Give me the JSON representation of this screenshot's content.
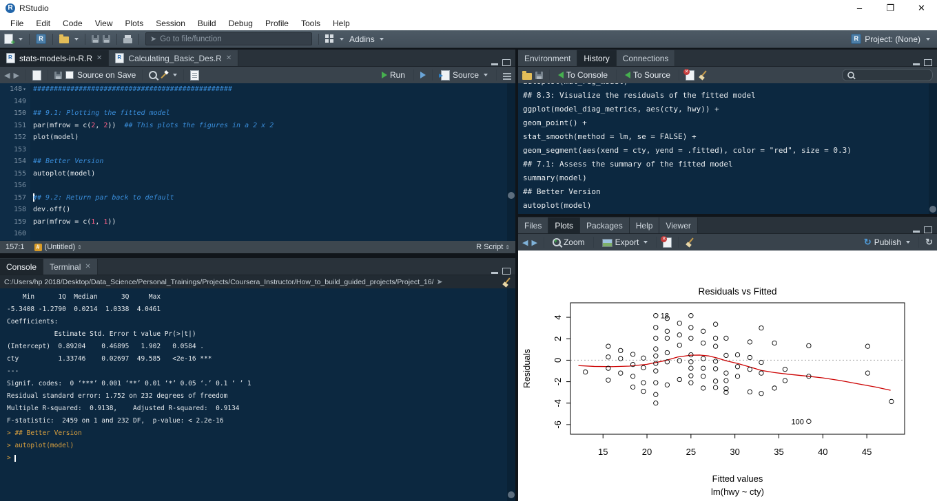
{
  "window": {
    "title": "RStudio"
  },
  "menubar": {
    "items": [
      "File",
      "Edit",
      "Code",
      "View",
      "Plots",
      "Session",
      "Build",
      "Debug",
      "Profile",
      "Tools",
      "Help"
    ]
  },
  "toolbar": {
    "goto_placeholder": "Go to file/function",
    "addins_label": "Addins",
    "project_label": "Project: (None)"
  },
  "source_pane": {
    "tabs": [
      {
        "label": "stats-models-in-R.R",
        "active": true,
        "closeable": true
      },
      {
        "label": "Calculating_Basic_Des.R",
        "active": false,
        "closeable": true
      }
    ],
    "toolbar": {
      "source_on_save": "Source on Save",
      "run": "Run",
      "source": "Source"
    },
    "code": [
      {
        "n": 148,
        "fold": true,
        "tok": [
          [
            "com",
            "################################################"
          ]
        ]
      },
      {
        "n": 149,
        "tok": []
      },
      {
        "n": 150,
        "tok": [
          [
            "com",
            "## 9.1: Plotting the fitted model"
          ]
        ]
      },
      {
        "n": 151,
        "tok": [
          [
            "txt",
            "par(mfrow = c("
          ],
          [
            "num",
            "2"
          ],
          [
            "txt",
            ", "
          ],
          [
            "num",
            "2"
          ],
          [
            "txt",
            "))  "
          ],
          [
            "com",
            "## This plots the figures in a 2 x 2"
          ]
        ]
      },
      {
        "n": 152,
        "tok": [
          [
            "txt",
            "plot(model)"
          ]
        ]
      },
      {
        "n": 153,
        "tok": []
      },
      {
        "n": 154,
        "tok": [
          [
            "com",
            "## Better Version"
          ]
        ]
      },
      {
        "n": 155,
        "tok": [
          [
            "txt",
            "autoplot(model)"
          ]
        ]
      },
      {
        "n": 156,
        "tok": []
      },
      {
        "n": 157,
        "cursor": true,
        "tok": [
          [
            "com",
            "## 9.2: Return par back to default"
          ]
        ]
      },
      {
        "n": 158,
        "tok": [
          [
            "txt",
            "dev.off()"
          ]
        ]
      },
      {
        "n": 159,
        "tok": [
          [
            "txt",
            "par(mfrow = c("
          ],
          [
            "num",
            "1"
          ],
          [
            "txt",
            ", "
          ],
          [
            "num",
            "1"
          ],
          [
            "txt",
            "))"
          ]
        ]
      },
      {
        "n": 160,
        "tok": []
      }
    ],
    "status": {
      "position": "157:1",
      "doc": "(Untitled)",
      "type": "R Script"
    }
  },
  "console_pane": {
    "tabs": [
      {
        "label": "Console",
        "active": true
      },
      {
        "label": "Terminal",
        "active": false,
        "closeable": true
      }
    ],
    "path": "C:/Users/hp 2018/Desktop/Data_Science/Personal_Trainings/Projects/Coursera_Instructor/How_to_build_guided_projects/Project_16/",
    "lines": [
      [
        "out",
        "    Min      1Q  Median      3Q     Max "
      ],
      [
        "out",
        "-5.3408 -1.2790  0.0214  1.0338  4.0461 "
      ],
      [
        "out",
        ""
      ],
      [
        "out",
        "Coefficients:"
      ],
      [
        "out",
        "            Estimate Std. Error t value Pr(>|t|)    "
      ],
      [
        "out",
        "(Intercept)  0.89204    0.46895   1.902   0.0584 .  "
      ],
      [
        "out",
        "cty          1.33746    0.02697  49.585   <2e-16 ***"
      ],
      [
        "out",
        "---"
      ],
      [
        "out",
        "Signif. codes:  0 ‘***’ 0.001 ‘**’ 0.01 ‘*’ 0.05 ‘.’ 0.1 ‘ ’ 1"
      ],
      [
        "out",
        ""
      ],
      [
        "out",
        "Residual standard error: 1.752 on 232 degrees of freedom"
      ],
      [
        "out",
        "Multiple R-squared:  0.9138,    Adjusted R-squared:  0.9134"
      ],
      [
        "out",
        "F-statistic:  2459 on 1 and 232 DF,  p-value: < 2.2e-16"
      ],
      [
        "out",
        ""
      ],
      [
        "cmd",
        "> ## Better Version"
      ],
      [
        "cmd",
        "> autoplot(model)"
      ],
      [
        "prompt",
        "> "
      ]
    ]
  },
  "history_pane": {
    "tabs": [
      {
        "label": "Environment",
        "active": false
      },
      {
        "label": "History",
        "active": true
      },
      {
        "label": "Connections",
        "active": false
      }
    ],
    "toolbar": {
      "to_console": "To Console",
      "to_source": "To Source",
      "search_value": ""
    },
    "lines": [
      "autoplot(mul_reg_model)",
      "## 8.3: Visualize the residuals of the fitted model",
      "ggplot(model_diag_metrics, aes(cty, hwy)) +",
      "geom_point() +",
      "stat_smooth(method = lm, se = FALSE) +",
      "geom_segment(aes(xend = cty, yend = .fitted), color = \"red\", size = 0.3)",
      "## 7.1: Assess the summary of the fitted model",
      "summary(model)",
      "## Better Version",
      "autoplot(model)"
    ]
  },
  "plots_pane": {
    "tabs": [
      {
        "label": "Files",
        "active": false
      },
      {
        "label": "Plots",
        "active": true
      },
      {
        "label": "Packages",
        "active": false
      },
      {
        "label": "Help",
        "active": false
      },
      {
        "label": "Viewer",
        "active": false
      }
    ],
    "toolbar": {
      "zoom": "Zoom",
      "export": "Export",
      "publish": "Publish"
    }
  },
  "chart_data": {
    "type": "scatter",
    "title": "Residuals vs Fitted",
    "xlabel": "Fitted values",
    "xlabel2": "lm(hwy ~ cty)",
    "ylabel": "Residuals",
    "x_ticks": [
      15,
      20,
      25,
      30,
      35,
      40,
      45
    ],
    "y_ticks": [
      4,
      2,
      0,
      -2,
      -4,
      -6
    ],
    "xlim": [
      11.3,
      49.3
    ],
    "ylim": [
      -6.9,
      5.35
    ],
    "grid": false,
    "zero_line": {
      "y": 0,
      "style": "dotted",
      "color": "#a6a6a6"
    },
    "point_color": "#000000",
    "smoother_color": "#cc0000",
    "points": [
      [
        13,
        -1.1
      ],
      [
        15.6,
        1.3
      ],
      [
        15.6,
        0.3
      ],
      [
        15.6,
        -0.75
      ],
      [
        15.6,
        -1.85
      ],
      [
        17,
        0.9
      ],
      [
        17,
        0.15
      ],
      [
        17,
        -1.2
      ],
      [
        18.4,
        0.55
      ],
      [
        18.4,
        -0.4
      ],
      [
        18.4,
        -1.5
      ],
      [
        18.4,
        -2.5
      ],
      [
        19.6,
        0.2
      ],
      [
        19.6,
        -0.7
      ],
      [
        19.6,
        -2.1
      ],
      [
        19.6,
        -2.9
      ],
      [
        21,
        4.15
      ],
      [
        21,
        3.05
      ],
      [
        21,
        2.05
      ],
      [
        21,
        1.05
      ],
      [
        21,
        0.4
      ],
      [
        21,
        -0.3
      ],
      [
        21,
        -1
      ],
      [
        21,
        -2.1
      ],
      [
        21,
        -3.2
      ],
      [
        21,
        -4
      ],
      [
        22.3,
        3.9
      ],
      [
        22.3,
        2.7
      ],
      [
        22.3,
        2.05
      ],
      [
        22.3,
        0.7
      ],
      [
        22.3,
        -0.15
      ],
      [
        22.3,
        -2.3
      ],
      [
        23.7,
        3.45
      ],
      [
        23.7,
        2.35
      ],
      [
        23.7,
        1.4
      ],
      [
        23.7,
        -0.05
      ],
      [
        23.7,
        -1.8
      ],
      [
        25,
        4.15
      ],
      [
        25,
        3.05
      ],
      [
        25,
        2.05
      ],
      [
        25,
        0.5
      ],
      [
        25,
        -0.15
      ],
      [
        25,
        -0.75
      ],
      [
        25,
        -1.45
      ],
      [
        25,
        -2.1
      ],
      [
        26.4,
        2.7
      ],
      [
        26.4,
        1.6
      ],
      [
        26.4,
        0.15
      ],
      [
        26.4,
        -0.75
      ],
      [
        26.4,
        -1.5
      ],
      [
        26.4,
        -2.6
      ],
      [
        27.8,
        3.35
      ],
      [
        27.8,
        2.05
      ],
      [
        27.8,
        1.3
      ],
      [
        27.8,
        -0.1
      ],
      [
        27.8,
        -0.8
      ],
      [
        27.8,
        -1.95
      ],
      [
        27.8,
        -2.55
      ],
      [
        29,
        2.05
      ],
      [
        29,
        0.45
      ],
      [
        29,
        -1.2
      ],
      [
        29,
        -1.9
      ],
      [
        29,
        -2.65
      ],
      [
        29,
        -3
      ],
      [
        30.3,
        0.5
      ],
      [
        30.3,
        -0.6
      ],
      [
        30.3,
        -1.5
      ],
      [
        31.7,
        1.7
      ],
      [
        31.7,
        0.25
      ],
      [
        31.7,
        -0.85
      ],
      [
        31.7,
        -2.95
      ],
      [
        33,
        3
      ],
      [
        33,
        -0.2
      ],
      [
        33,
        -1.2
      ],
      [
        33,
        -3.1
      ],
      [
        34.5,
        1.6
      ],
      [
        34.5,
        -2.6
      ],
      [
        35.7,
        -0.85
      ],
      [
        35.7,
        -1.9
      ],
      [
        38.4,
        1.35
      ],
      [
        38.4,
        -1.5
      ],
      [
        38.4,
        -5.7
      ],
      [
        45.1,
        1.3
      ],
      [
        45.1,
        -1.2
      ],
      [
        47.8,
        -3.85
      ]
    ],
    "smoother": [
      [
        12.2,
        -0.5
      ],
      [
        14,
        -0.58
      ],
      [
        16,
        -0.6
      ],
      [
        18,
        -0.55
      ],
      [
        20,
        -0.38
      ],
      [
        22,
        -0.05
      ],
      [
        23.5,
        0.3
      ],
      [
        25,
        0.47
      ],
      [
        26,
        0.48
      ],
      [
        27,
        0.4
      ],
      [
        28,
        0.2
      ],
      [
        29,
        -0.05
      ],
      [
        30.3,
        -0.3
      ],
      [
        32,
        -0.7
      ],
      [
        33,
        -0.95
      ],
      [
        34.5,
        -1.15
      ],
      [
        36,
        -1.3
      ],
      [
        38.4,
        -1.5
      ],
      [
        40,
        -1.65
      ],
      [
        42,
        -1.9
      ],
      [
        44,
        -2.2
      ],
      [
        46,
        -2.5
      ],
      [
        47.7,
        -2.8
      ]
    ],
    "labeled_points": [
      {
        "label": "18",
        "x": 21,
        "y": 4.15,
        "side": "right"
      },
      {
        "label": "100",
        "x": 38.4,
        "y": -5.7,
        "side": "left"
      }
    ]
  }
}
